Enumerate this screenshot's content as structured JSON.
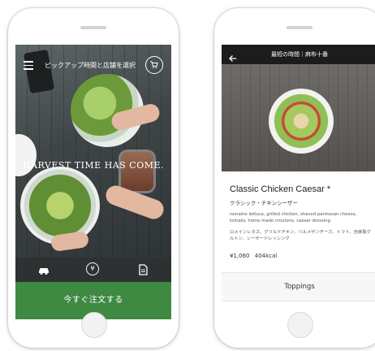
{
  "left_screen": {
    "header": {
      "time_select_label": "ピックアップ時間と店舗を選択"
    },
    "hero": {
      "tagline": "HARVEST TIME HAS COME."
    },
    "tabbar": {
      "yen_symbol": "¥"
    },
    "order_button_label": "今すぐ注文する"
  },
  "right_screen": {
    "header": {
      "title": "最短の時間｜麻布十番"
    },
    "dish": {
      "name": "Classic Chicken Caesar *",
      "name_jp": "クラシック・チキンシーザー",
      "description_en": "romaine lettuce, grilled chicken, shaved parmesan cheese, tomato, home made croutons, caesar dressing",
      "description_jp": "ロメインレタス、グリルドチキン、パルメザンチーズ、トマト、自家製クルトン、シーザードレッシング",
      "price": "¥1,060",
      "calories": "404kcal"
    },
    "toppings_label": "Toppings"
  },
  "colors": {
    "accent_green": "#3f8a43",
    "header_dark": "#1c1c1c"
  }
}
